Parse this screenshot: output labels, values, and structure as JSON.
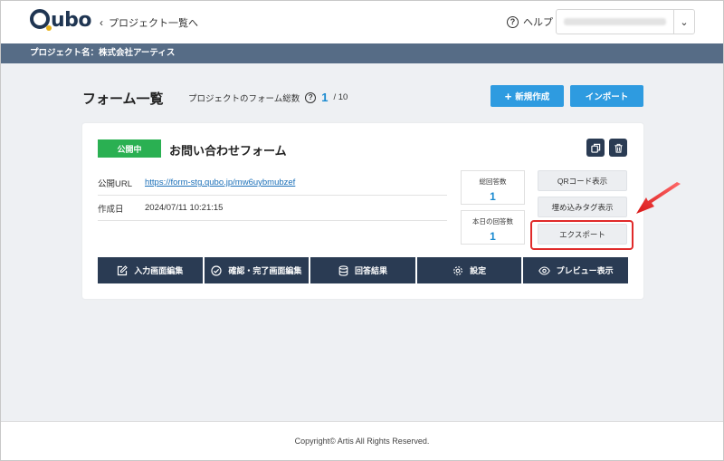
{
  "header": {
    "logo": "Qubo",
    "back_label": "プロジェクト一覧へ",
    "help_label": "ヘルプ"
  },
  "project_bar": {
    "label": "プロジェクト名：株式会社アーティス"
  },
  "page": {
    "title": "フォーム一覧",
    "total_label": "プロジェクトのフォーム総数",
    "total_count": "1",
    "total_max": "/ 10",
    "new_button": "新規作成",
    "import_button": "インポート"
  },
  "form_card": {
    "status": "公開中",
    "name": "お問い合わせフォーム",
    "url_label": "公開URL",
    "url": "https://form-stg.qubo.jp/mw6uybmubzef",
    "created_label": "作成日",
    "created": "2024/07/11 10:21:15",
    "stats": [
      {
        "label": "総回答数",
        "value": "1"
      },
      {
        "label": "本日の回答数",
        "value": "1"
      }
    ],
    "side_buttons": [
      "QRコード表示",
      "埋め込みタグ表示",
      "エクスポート"
    ],
    "actions": [
      "入力画面編集",
      "確認・完了画面編集",
      "回答結果",
      "設定",
      "プレビュー表示"
    ]
  },
  "footer": {
    "copyright": "Copyright© Artis All Rights Reserved."
  },
  "colors": {
    "navy": "#2a3b53",
    "accent_blue": "#2e9be0",
    "status_green": "#2ab052",
    "highlight_red": "#e02a2a"
  }
}
